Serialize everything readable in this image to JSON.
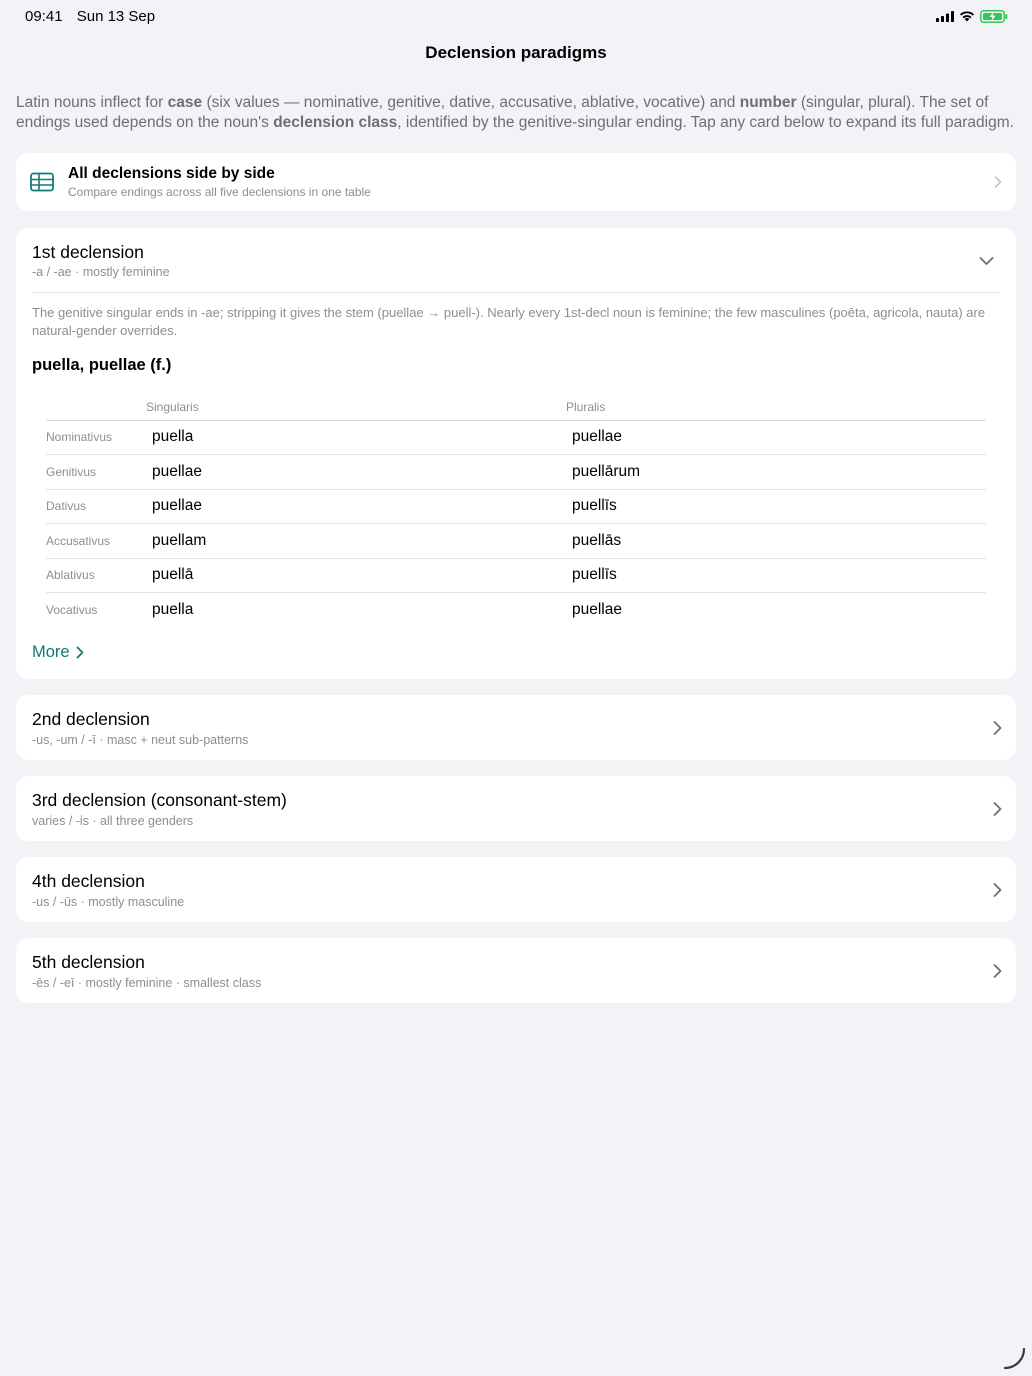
{
  "status": {
    "time": "09:41",
    "date": "Sun 13 Sep"
  },
  "nav": {
    "title": "Declension paradigms"
  },
  "intro": {
    "p1": "Latin nouns inflect for ",
    "b1": "case",
    "p2": " (six values — nominative, genitive, dative, accusative, ablative, vocative) and ",
    "b2": "number",
    "p3": " (singular, plural). The set of endings used depends on the noun's ",
    "b3": "declension class",
    "p4": ", identified by the genitive-singular ending. Tap any card below to expand its full paradigm."
  },
  "all_card": {
    "title": "All declensions side by side",
    "subtitle": "Compare endings across all five declensions in one table",
    "icon": "table-icon"
  },
  "first": {
    "title": "1st declension",
    "subtitle": "-a / -ae · mostly feminine",
    "note": "The genitive singular ends in -ae; stripping it gives the stem (puellae → puell-). Nearly every 1st-decl noun is feminine; the few masculines (poēta, agricola, nauta) are natural-gender overrides.",
    "lemma": "puella, puellae (f.)",
    "headers": [
      "",
      "Singularis",
      "Pluralis"
    ],
    "rows": [
      {
        "case": "Nominativus",
        "sg": "puella",
        "pl": "puellae"
      },
      {
        "case": "Genitivus",
        "sg": "puellae",
        "pl": "puellārum"
      },
      {
        "case": "Dativus",
        "sg": "puellae",
        "pl": "puellīs"
      },
      {
        "case": "Accusativus",
        "sg": "puellam",
        "pl": "puellās"
      },
      {
        "case": "Ablativus",
        "sg": "puellā",
        "pl": "puellīs"
      },
      {
        "case": "Vocativus",
        "sg": "puella",
        "pl": "puellae"
      }
    ],
    "more_label": "More"
  },
  "declensions": [
    {
      "title": "2nd declension",
      "subtitle": "-us, -um / -ī · masc + neut sub-patterns"
    },
    {
      "title": "3rd declension (consonant-stem)",
      "subtitle": "varies / -is · all three genders"
    },
    {
      "title": "4th declension",
      "subtitle": "-us / -ūs · mostly masculine"
    },
    {
      "title": "5th declension",
      "subtitle": "-ēs / -eī · mostly feminine · smallest class"
    }
  ],
  "colors": {
    "accent": "#117a7a",
    "background": "#f2f2f7",
    "secondary_text": "#8e8e93"
  }
}
